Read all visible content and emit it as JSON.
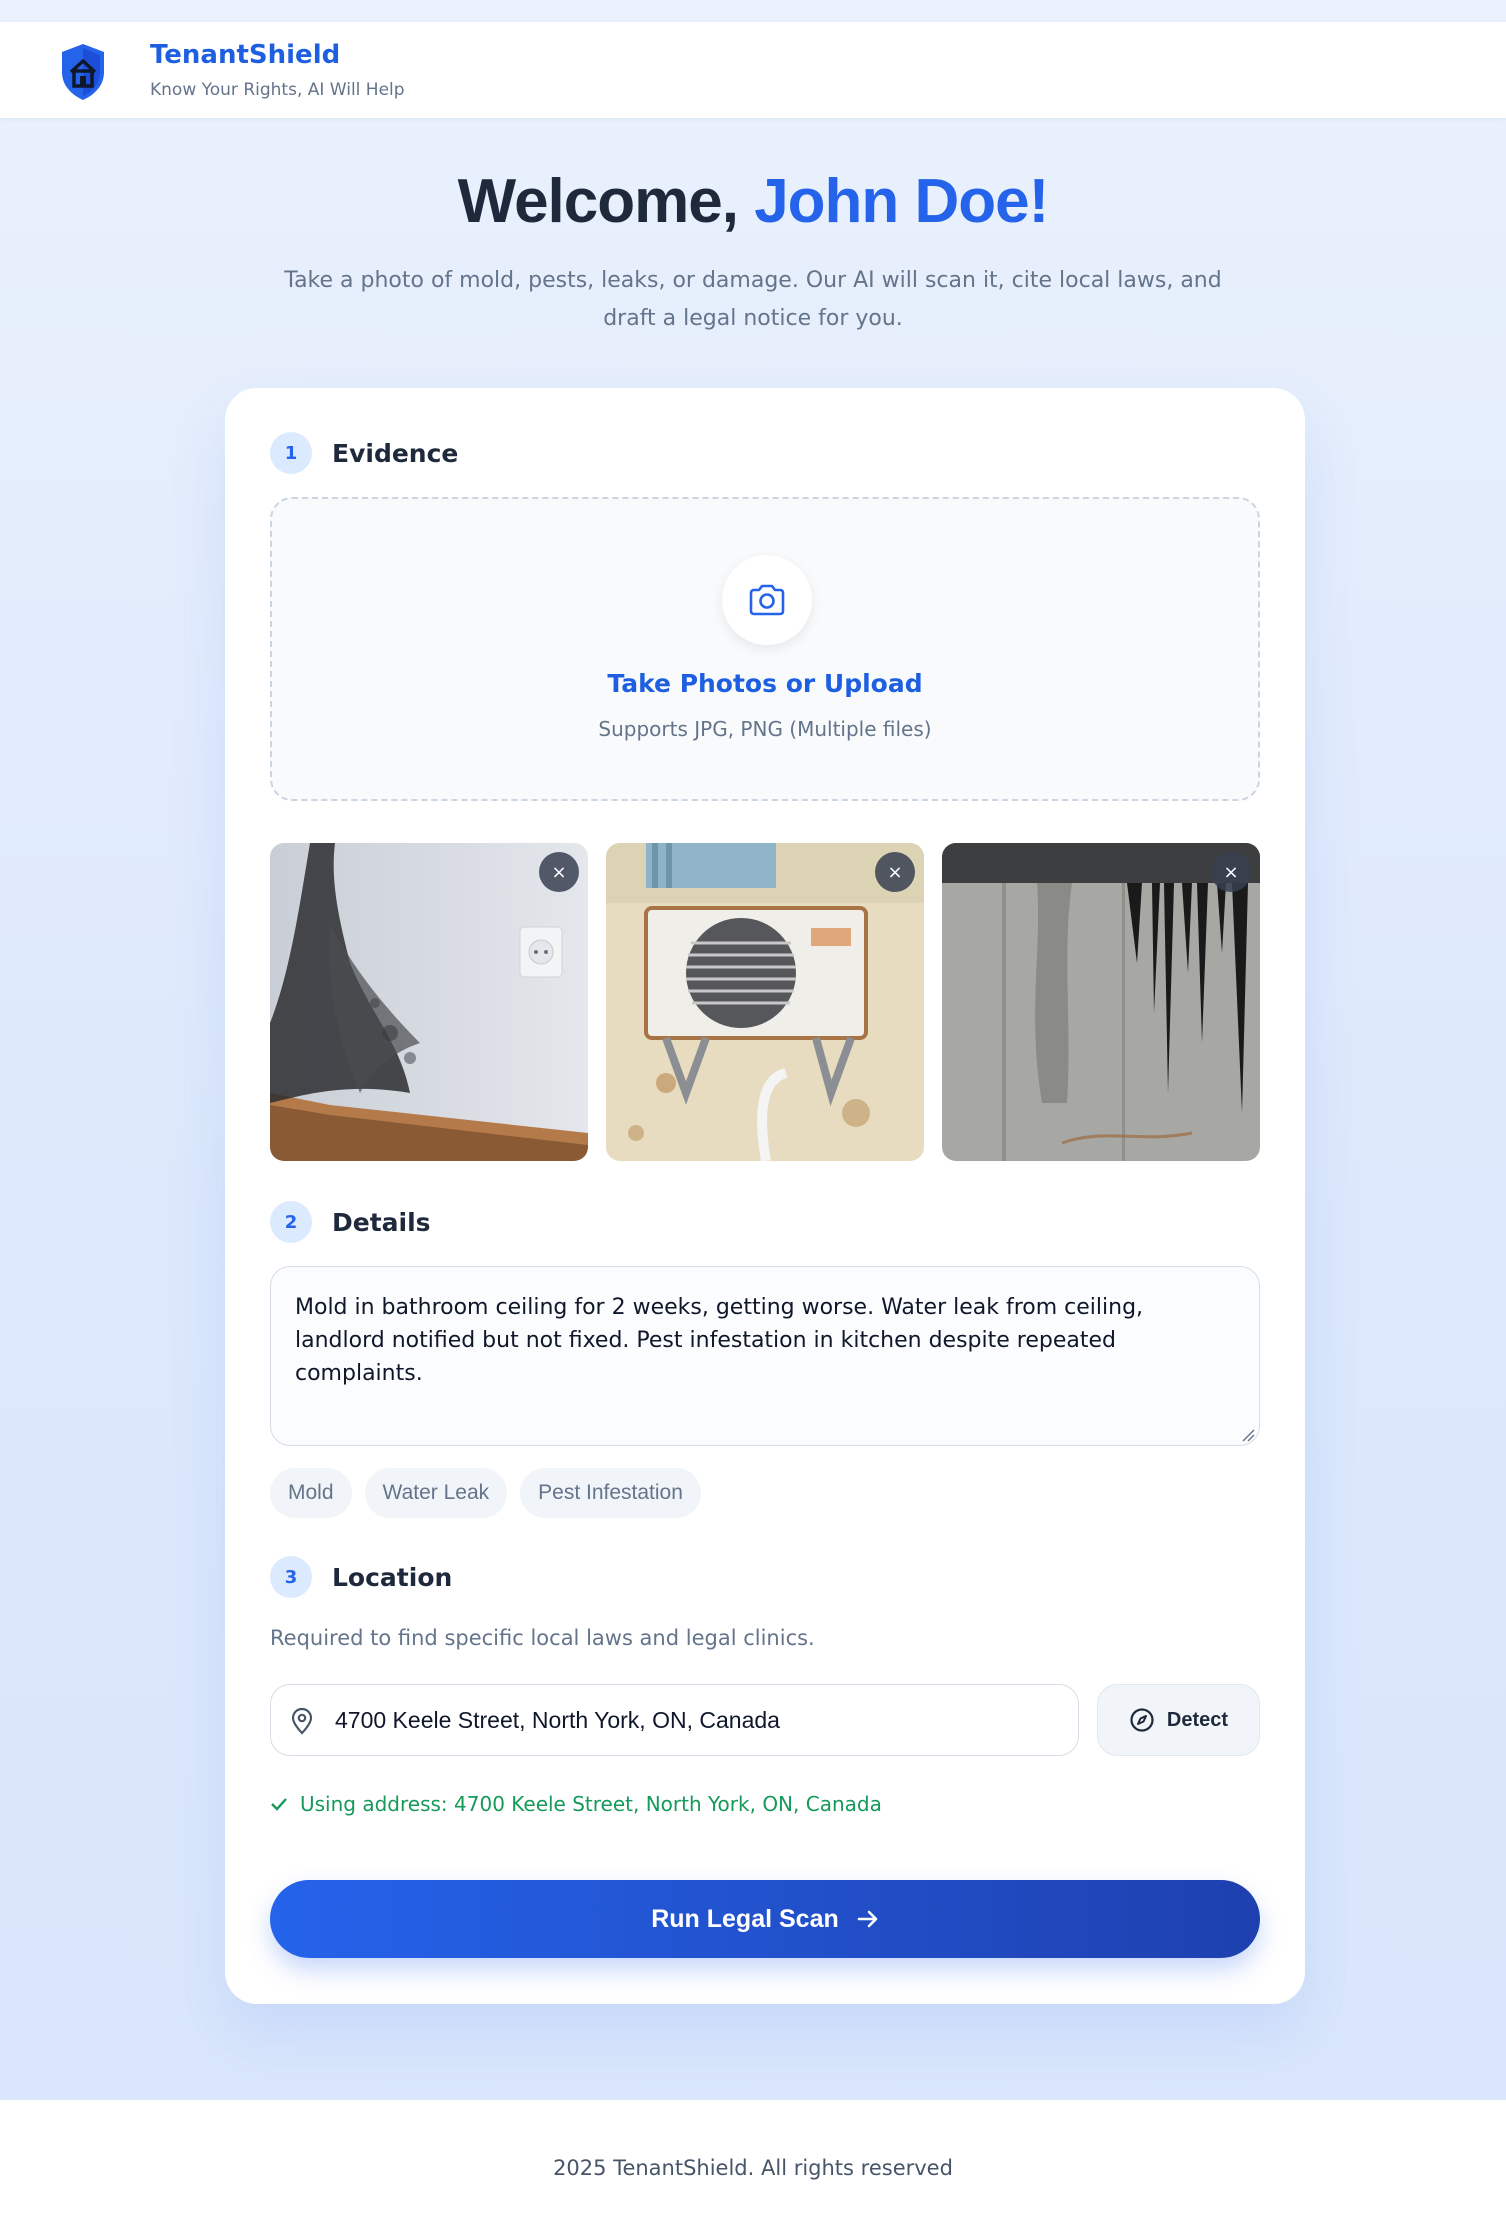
{
  "header": {
    "brand_title": "TenantShield",
    "brand_tagline": "Know Your Rights, AI Will Help"
  },
  "hero": {
    "greeting": "Welcome, ",
    "user_name": "John Doe!",
    "subtitle": "Take a photo of mold, pests, leaks, or damage. Our AI will scan it, cite local laws, and draft a legal notice for you."
  },
  "evidence": {
    "step_number": "1",
    "step_title": "Evidence",
    "upload_title": "Take Photos or Upload",
    "upload_subtitle": "Supports JPG, PNG (Multiple files)",
    "photos": [
      {
        "subject": "mold-wall",
        "remove_label": "×"
      },
      {
        "subject": "rusty-ac-unit",
        "remove_label": "×"
      },
      {
        "subject": "water-leak-stain",
        "remove_label": "×"
      }
    ]
  },
  "details": {
    "step_number": "2",
    "step_title": "Details",
    "description": "Mold in bathroom ceiling for 2 weeks, getting worse. Water leak from ceiling, landlord notified but not fixed. Pest infestation in kitchen despite repeated complaints.",
    "tags": [
      "Mold",
      "Water Leak",
      "Pest Infestation"
    ]
  },
  "location": {
    "step_number": "3",
    "step_title": "Location",
    "help_text": "Required to find specific local laws and legal clinics.",
    "address_value": "4700 Keele Street, North York, ON, Canada",
    "detect_label": "Detect",
    "confirmation": "Using address: 4700 Keele Street, North York, ON, Canada"
  },
  "actions": {
    "run_label": "Run Legal Scan"
  },
  "footer": {
    "text": "2025 TenantShield. All rights reserved"
  },
  "colors": {
    "primary": "#2563eb",
    "primary_dark": "#1e40af",
    "success": "#169a5a",
    "muted": "#64748b"
  }
}
